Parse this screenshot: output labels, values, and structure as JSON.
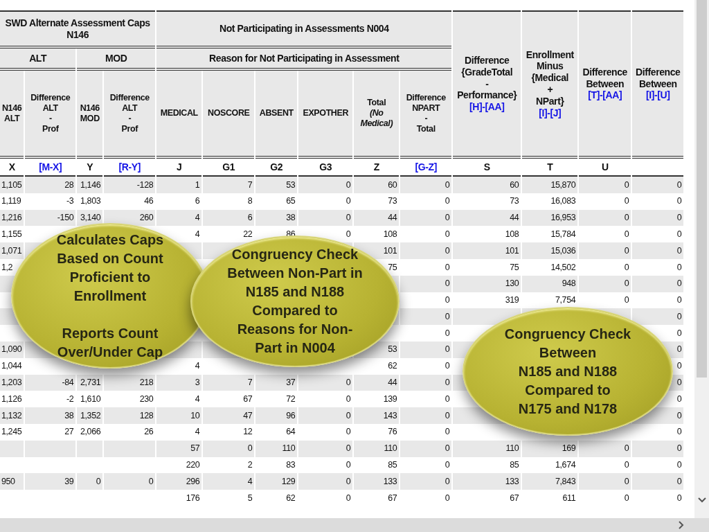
{
  "table": {
    "group_headers": [
      {
        "text": "SWD Alternate Assessment Caps N146"
      },
      {
        "text": "Not Participating in Assessments N004"
      }
    ],
    "sub_headers": [
      {
        "text": "ALT"
      },
      {
        "text": "MOD"
      },
      {
        "text": "Reason for Not Participating in Assessment"
      }
    ],
    "columns": [
      {
        "lines": [
          "N146",
          "ALT"
        ],
        "letter": {
          "text": "X",
          "kind": "column"
        }
      },
      {
        "lines": [
          "Difference",
          "ALT",
          "-",
          "Prof"
        ],
        "letter": {
          "text": "[M-X]",
          "kind": "formula"
        }
      },
      {
        "lines": [
          "N146",
          "MOD"
        ],
        "letter": {
          "text": "Y",
          "kind": "column"
        }
      },
      {
        "lines": [
          "Difference",
          "ALT",
          "-",
          "Prof"
        ],
        "letter": {
          "text": "[R-Y]",
          "kind": "formula"
        }
      },
      {
        "lines": [
          "MEDICAL"
        ],
        "letter": {
          "text": "J",
          "kind": "column"
        }
      },
      {
        "lines": [
          "NOSCORE"
        ],
        "letter": {
          "text": "G1",
          "kind": "column"
        }
      },
      {
        "lines": [
          "ABSENT"
        ],
        "letter": {
          "text": "G2",
          "kind": "column"
        }
      },
      {
        "lines": [
          "EXPOTHER"
        ],
        "letter": {
          "text": "G3",
          "kind": "column"
        }
      },
      {
        "lines": [
          "Total",
          "*(No*",
          "*Medical)*"
        ],
        "letter": {
          "text": "Z",
          "kind": "column"
        }
      },
      {
        "lines": [
          "Difference",
          "NPART",
          "-",
          "Total"
        ],
        "letter": {
          "text": "[G-Z]",
          "kind": "formula"
        }
      },
      {
        "lines": [
          "Difference",
          "{GradeTotal",
          "-",
          "Performance}"
        ],
        "code": "[H]-[AA]",
        "letter": {
          "text": "S",
          "kind": "column"
        }
      },
      {
        "lines": [
          "Enrollment",
          "Minus",
          "{Medical",
          "+",
          "NPart}"
        ],
        "code": "[I]-[J]",
        "letter": {
          "text": "T",
          "kind": "column"
        }
      },
      {
        "lines": [
          "Difference",
          "Between"
        ],
        "code": "[T]-[AA]",
        "letter": {
          "text": "U",
          "kind": "column"
        }
      },
      {
        "lines": [
          "Difference",
          "Between"
        ],
        "code": "[I]-[U]"
      }
    ],
    "rows": [
      [
        "1,105",
        "28",
        "1,146",
        "-128",
        "1",
        "7",
        "53",
        "0",
        "60",
        "0",
        "60",
        "15,870",
        "0",
        "0"
      ],
      [
        "1,119",
        "-3",
        "1,803",
        "46",
        "6",
        "8",
        "65",
        "0",
        "73",
        "0",
        "73",
        "16,083",
        "0",
        "0"
      ],
      [
        "1,216",
        "-150",
        "3,140",
        "260",
        "4",
        "6",
        "38",
        "0",
        "44",
        "0",
        "44",
        "16,953",
        "0",
        "0"
      ],
      [
        "1,155",
        null,
        null,
        null,
        "4",
        "22",
        "86",
        "0",
        "108",
        "0",
        "108",
        "15,784",
        "0",
        "0"
      ],
      [
        "1,071",
        null,
        null,
        null,
        null,
        null,
        null,
        null,
        "101",
        "0",
        "101",
        "15,036",
        "0",
        "0"
      ],
      [
        "1,2",
        null,
        null,
        null,
        null,
        null,
        null,
        null,
        "75",
        "0",
        "75",
        "14,502",
        "0",
        "0"
      ],
      [
        null,
        null,
        null,
        null,
        null,
        null,
        null,
        null,
        null,
        "0",
        "130",
        "948",
        "0",
        "0"
      ],
      [
        null,
        null,
        null,
        null,
        null,
        null,
        null,
        null,
        null,
        "0",
        "319",
        "7,754",
        "0",
        "0"
      ],
      [
        null,
        null,
        null,
        null,
        null,
        null,
        null,
        null,
        null,
        "0",
        null,
        null,
        null,
        "0"
      ],
      [
        null,
        null,
        null,
        null,
        null,
        null,
        null,
        null,
        null,
        "0",
        null,
        null,
        null,
        "0"
      ],
      [
        "1,090",
        null,
        null,
        null,
        null,
        null,
        null,
        null,
        "53",
        "0",
        null,
        null,
        null,
        "0"
      ],
      [
        "1,044",
        null,
        null,
        null,
        "4",
        null,
        null,
        null,
        "62",
        "0",
        null,
        null,
        null,
        "0"
      ],
      [
        "1,203",
        "-84",
        "2,731",
        "218",
        "3",
        "7",
        "37",
        "0",
        "44",
        "0",
        null,
        null,
        null,
        "0"
      ],
      [
        "1,126",
        "-2",
        "1,610",
        "230",
        "4",
        "67",
        "72",
        "0",
        "139",
        "0",
        null,
        null,
        null,
        "0"
      ],
      [
        "1,132",
        "38",
        "1,352",
        "128",
        "10",
        "47",
        "96",
        "0",
        "143",
        "0",
        null,
        null,
        null,
        "0"
      ],
      [
        "1,245",
        "27",
        "2,066",
        "26",
        "4",
        "12",
        "64",
        "0",
        "76",
        "0",
        null,
        null,
        null,
        "0"
      ],
      [
        null,
        null,
        null,
        null,
        "57",
        "0",
        "110",
        "0",
        "110",
        "0",
        "110",
        "169",
        "0",
        "0"
      ],
      [
        null,
        null,
        null,
        null,
        "220",
        "2",
        "83",
        "0",
        "85",
        "0",
        "85",
        "1,674",
        "0",
        "0"
      ],
      [
        "950",
        "39",
        "0",
        "0",
        "296",
        "4",
        "129",
        "0",
        "133",
        "0",
        "133",
        "7,843",
        "0",
        "0"
      ],
      [
        null,
        null,
        null,
        null,
        "176",
        "5",
        "62",
        "0",
        "67",
        "0",
        "67",
        "611",
        "0",
        "0"
      ]
    ]
  },
  "callouts": [
    {
      "text": "Calculates Caps\nBased on Count\nProficient to\nEnrollment\n\nReports Count\nOver/Under Cap"
    },
    {
      "text": "Congruency Check\nBetween Non-Part in\nN185 and N188\nCompared to\nReasons for Non-\nPart in N004"
    },
    {
      "text": "Congruency Check\nBetween\nN185 and N188\nCompared to\nN175 and N178"
    }
  ]
}
